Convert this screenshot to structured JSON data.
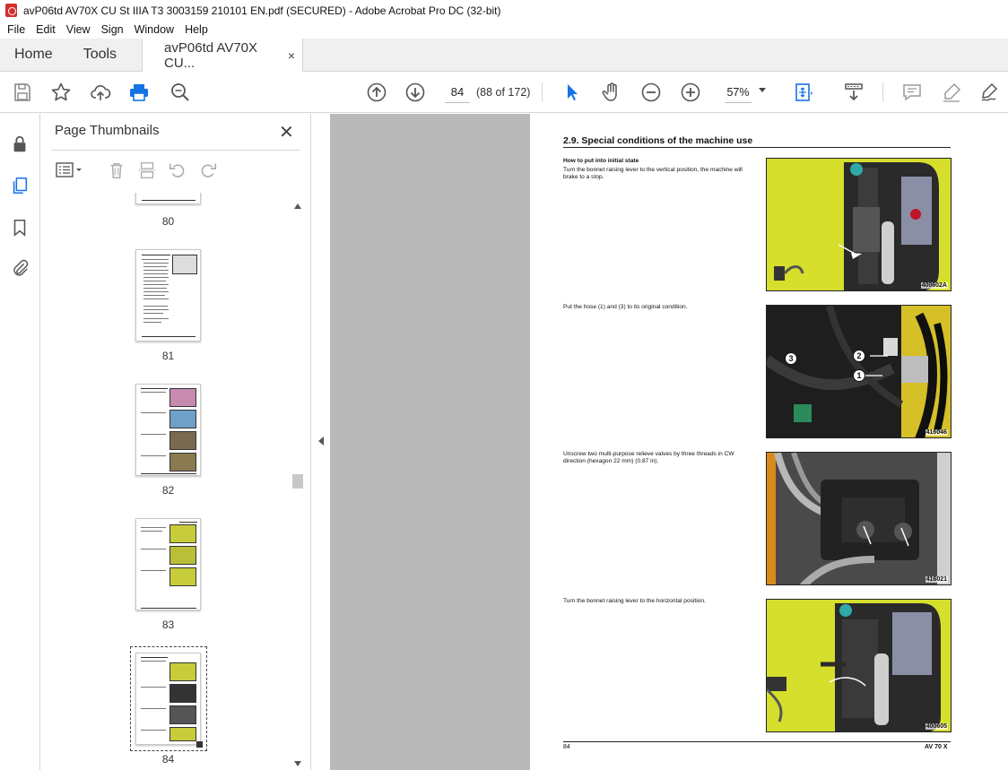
{
  "window": {
    "title": "avP06td AV70X CU St IIIA T3 3003159 210101 EN.pdf (SECURED) - Adobe Acrobat Pro DC (32-bit)"
  },
  "menu": [
    "File",
    "Edit",
    "View",
    "Sign",
    "Window",
    "Help"
  ],
  "tabs": {
    "home": "Home",
    "tools": "Tools",
    "document": "avP06td AV70X CU...",
    "close": "×"
  },
  "toolbar": {
    "page_current": "84",
    "page_count": "(88 of 172)",
    "zoom": "57%"
  },
  "thumbnails": {
    "header": "Page Thumbnails",
    "close": "✕",
    "pages": [
      "80",
      "81",
      "82",
      "83",
      "84"
    ]
  },
  "document": {
    "section_title": "2.9.    Special conditions of the machine use",
    "subheading": "How to put into initial state",
    "steps": [
      "Turn the bonnet raising lever to the vertical position, the machine will brake to a stop.",
      "Put the hose (1) and (3) to its original condition.",
      "Unscrew two multi-purpose relieve valves by three threads in CW direction (hexagon 22 mm) (0.87 in).",
      "Turn the bonnet raising lever to the horizontal position."
    ],
    "photo_codes": [
      "400602A",
      "416046",
      "416021",
      "400605"
    ],
    "callouts": [
      "1",
      "2",
      "3"
    ],
    "footer_left": "84",
    "footer_right": "AV 70 X"
  },
  "colors": {
    "accent": "#1473e6",
    "acrobat_red": "#d32f2f",
    "bonnet_yellow": "#d6df2c",
    "canvas_gray": "#b9b9b9"
  }
}
